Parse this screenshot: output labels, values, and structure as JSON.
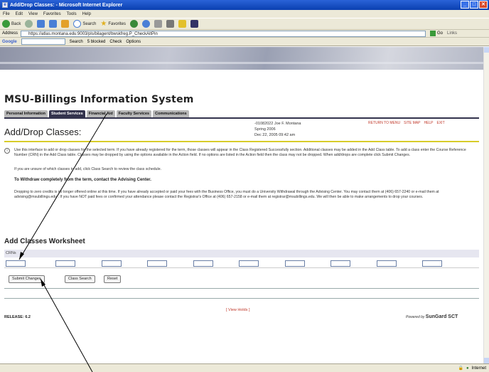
{
  "window": {
    "title": "Add/Drop Classes: - Microsoft Internet Explorer",
    "min": "_",
    "max": "□",
    "close": "✕"
  },
  "menu": [
    "File",
    "Edit",
    "View",
    "Favorites",
    "Tools",
    "Help"
  ],
  "toolbar": {
    "back": "Back",
    "search": "Search",
    "favorites": "Favorites"
  },
  "address": {
    "label": "Address",
    "url": "https://atlas.montana.edu:9003/pls/bilagent/bwskfreg.P_CheckAltPin",
    "go": "Go",
    "links": "Links"
  },
  "googlebar": {
    "label": "Google",
    "search": "Search",
    "blocked": "5 blocked",
    "check": "Check",
    "options": "Options"
  },
  "page": {
    "system_title": "MSU-Billings Information System",
    "tabs": [
      "Personal Information",
      "Student Services",
      "Financial Aid",
      "Faculty Services",
      "Communications"
    ],
    "active_tab": "Student Services",
    "title": "Add/Drop Classes:",
    "top_links": [
      "RETURN TO MENU",
      "SITE MAP",
      "HELP",
      "EXIT"
    ],
    "user": {
      "id_name": "-01082022 Joe F. Montana",
      "term": "Spring 2006",
      "date": "Dec 22, 2005 09:42 am"
    },
    "info_text_1": "Use this interface to add or drop classes for the selected term. If you have already registered for the term, those classes will appear in the Class Registered Successfully section. Additional classes may be added in the Add Class table. To add a class enter the Course Reference Number (CRN) in the Add Class table. Classes may be dropped by using the options available in the Action field. If no options are listed in the Action field then the class may not be dropped. When add/drops are complete click Submit Changes.",
    "info_text_2": "If you are unsure of which classes to add, click Class Search to review the class schedule.",
    "withdraw_heading": "To Withdraw completely from the term, contact the Advising Center.",
    "info_text_3": "Dropping to zero credits is no longer offered online at this time. If you have already accepted or paid your fees with the Business Office, you must do a University Withdrawal through the Advising Center. You may contact them at (406) 657-2240 or e-mail them at advising@msubillings.edu . If you have NOT paid fees or confirmed your attendance please contact the Registrar's Office at (406) 657-2158 or e-mail them at registrar@msubillings.edu. We will then be able to make arrangements to drop your courses.",
    "worksheet_title": "Add Classes Worksheet",
    "crn_label": "CRNs",
    "crn_values": [
      "",
      "",
      "",
      "",
      "",
      "",
      "",
      "",
      "",
      ""
    ],
    "buttons": {
      "submit": "Submit Changes",
      "class_search": "Class Search",
      "reset": "Reset"
    },
    "view_holds": "[ View Holds ]",
    "release": "RELEASE: 6.2",
    "powered_by": "Powered by",
    "vendor": "SunGard SCT"
  },
  "status": {
    "zone": "Internet"
  },
  "colors": {
    "tab_active": "#33334d",
    "tab_inactive": "#b7b7b7",
    "gold_rule": "#d8cc2a",
    "link_red": "#c0392b",
    "titlebar": "#2a63d8"
  }
}
